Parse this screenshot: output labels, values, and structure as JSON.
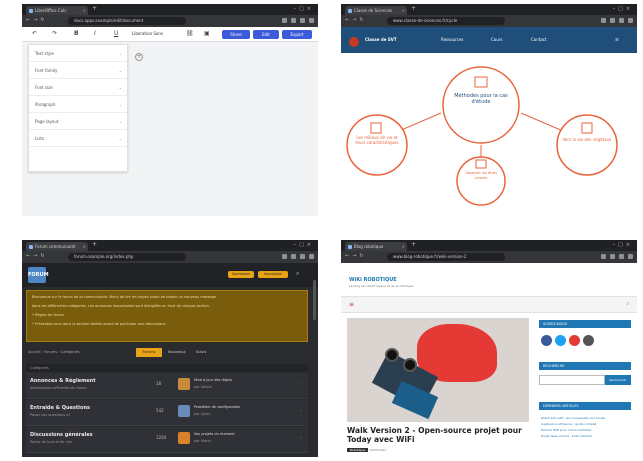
{
  "colors": {
    "accent_blue": "#3b5bdb",
    "site_header": "#1e4e79",
    "diagram_orange": "#e8633a",
    "forum_yellow": "#e8a317",
    "blog_blue": "#1f77b4",
    "hero_red": "#e53935"
  },
  "s1": {
    "tab_title": "LibreOffice Calc",
    "url": "docs.apps.example/edit/document",
    "font_name": "Liberation Sans",
    "buttons": [
      "Share",
      "Edit",
      "Export"
    ],
    "panel_items": [
      "Text style",
      "Font family",
      "Font size",
      "Paragraph",
      "Page layout",
      "Lists"
    ],
    "icons": [
      "undo-icon",
      "redo-icon",
      "bold-icon",
      "italic-icon",
      "underline-icon",
      "link-icon",
      "image-icon"
    ]
  },
  "s2": {
    "tab_title": "Classe de Sciences",
    "url": "www.classe-de-sciences.fr/cycle",
    "site_name": "Classe de SVT",
    "nav": [
      "Ressources",
      "Cours",
      "Contact"
    ],
    "nodes": {
      "center": "Méthodes pour la cas d'étude",
      "left": "Les milieux de vie et leurs caractéristiques",
      "right": "Vers la vie des végétaux",
      "bottom": "Observer les êtres vivants"
    }
  },
  "s3": {
    "tab_title": "Forum communauté",
    "url": "forum.example.org/index.php",
    "logo": "FORUM",
    "buttons": [
      "Connexion",
      "Inscription"
    ],
    "notice_lines": [
      "Bienvenue sur le forum de la communauté. Merci de lire les règles avant de poster un nouveau message",
      "dans les différentes catégories. Les annonces importantes sont épinglées en haut de chaque section.",
      "• Règles du forum",
      "• Présentez-vous dans la section dédiée avant de participer aux discussions."
    ],
    "breadcrumb": "Accueil › Forums › Catégories",
    "tabs": [
      "Forums",
      "Nouveaux",
      "Suivis"
    ],
    "category_header": "Catégories",
    "rows": [
      {
        "title": "Annonces & Règlement",
        "sub": "Informations officielles du forum",
        "count": "18",
        "last": "Mise à jour des règles",
        "last_sub": "par Admin",
        "avatar": "#c98b3a"
      },
      {
        "title": "Entraide & Questions",
        "sub": "Posez vos questions ici",
        "count": "542",
        "last": "Problème de configuration",
        "last_sub": "par Julien",
        "avatar": "#6a8bb8"
      },
      {
        "title": "Discussions générales",
        "sub": "Parlez de tout et de rien",
        "count": "1204",
        "last": "Vos projets du moment",
        "last_sub": "par Marie",
        "avatar": "#d9822b"
      }
    ]
  },
  "s4": {
    "tab_title": "Blog robotique",
    "url": "www.blog-robotique.fr/wiki-version-2",
    "blog_name": "WiKi ROBOTIQUE",
    "tagline": "Le blog de l'électronique et de la robotique",
    "post_title": "Walk Version 2 - Open-source projet pour Today avec WiFi",
    "post_category": "Robotique",
    "post_date": "13/05/2021",
    "widgets": [
      "SUIVEZ-NOUS",
      "RECHERCHE",
      "DERNIERS ARTICLES"
    ],
    "search_button": "Rechercher",
    "social_colors": [
      "#3b5998",
      "#1da1f2",
      "#e53935",
      "#555555"
    ],
    "links": [
      "Robot éducatif : les nouveautés de l'année",
      "Capteurs à ultrasons : guide complet",
      "Tutoriel WiFi pour microcontrôleur",
      "Projet open-source : bras robotisé"
    ]
  }
}
